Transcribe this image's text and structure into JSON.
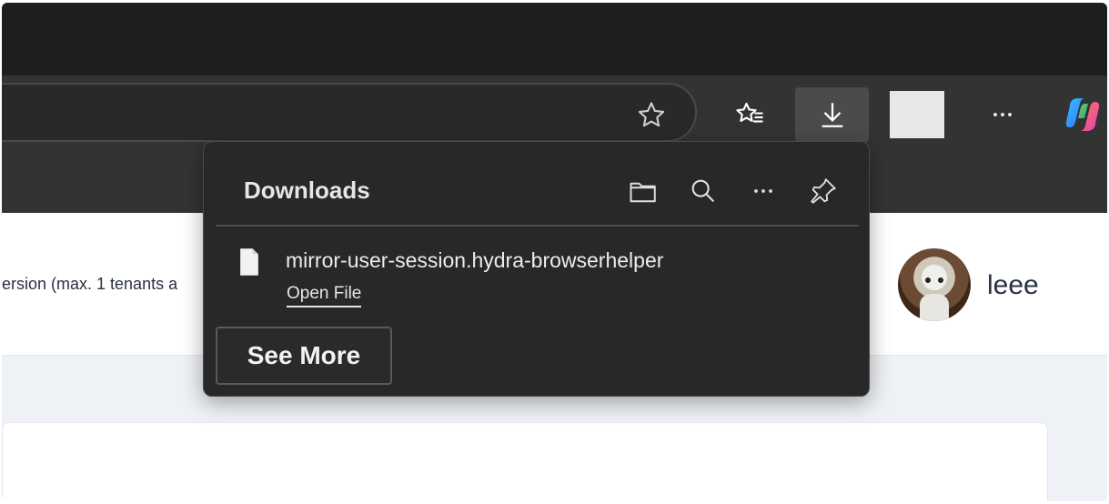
{
  "browser": {
    "toolbar": {
      "address_favorite_icon": "star-outline-icon",
      "favorites_icon": "star-list-icon",
      "downloads_icon": "download-arrow-icon",
      "more_icon": "ellipsis-icon",
      "copilot_icon": "copilot-icon"
    }
  },
  "page": {
    "partial_text": "ersion (max. 1 tenants a",
    "user_name": "leee"
  },
  "downloads_panel": {
    "title": "Downloads",
    "header_icons": [
      "open-folder-icon",
      "search-icon",
      "ellipsis-icon",
      "pin-icon"
    ],
    "items": [
      {
        "file_name": "mirror-user-session.hydra-browserhelper",
        "action_label": "Open File",
        "icon": "file-icon"
      }
    ],
    "see_more_label": "See More"
  },
  "colors": {
    "title_bar": "#1e1e1e",
    "toolbar": "#333333",
    "panel_bg": "#282828",
    "page_text": "#2a3144"
  }
}
